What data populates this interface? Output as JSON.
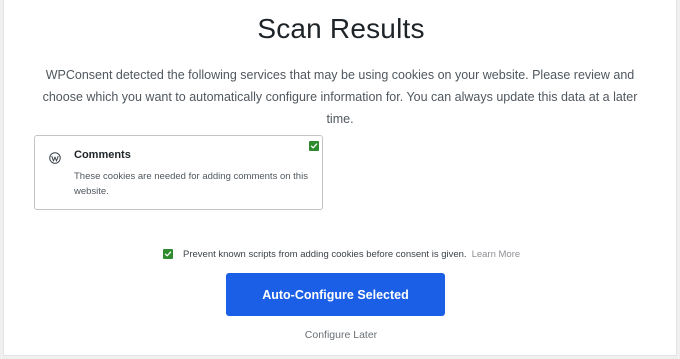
{
  "page": {
    "title": "Scan Results",
    "description": "WPConsent detected the following services that may be using cookies on your website. Please review and choose which you want to automatically configure information for. You can always update this data at a later time."
  },
  "services": [
    {
      "icon": "wordpress-icon",
      "name": "Comments",
      "description": "These cookies are needed for adding comments on this website.",
      "selected": true
    }
  ],
  "prevent_scripts": {
    "checked": true,
    "label": "Prevent known scripts from adding cookies before consent is given.",
    "link_label": "Learn More"
  },
  "actions": {
    "primary_label": "Auto-Configure Selected",
    "secondary_label": "Configure Later"
  },
  "colors": {
    "accent": "#1a5fe6",
    "checkbox": "#2e8b2e",
    "background": "#f0f0f1"
  }
}
